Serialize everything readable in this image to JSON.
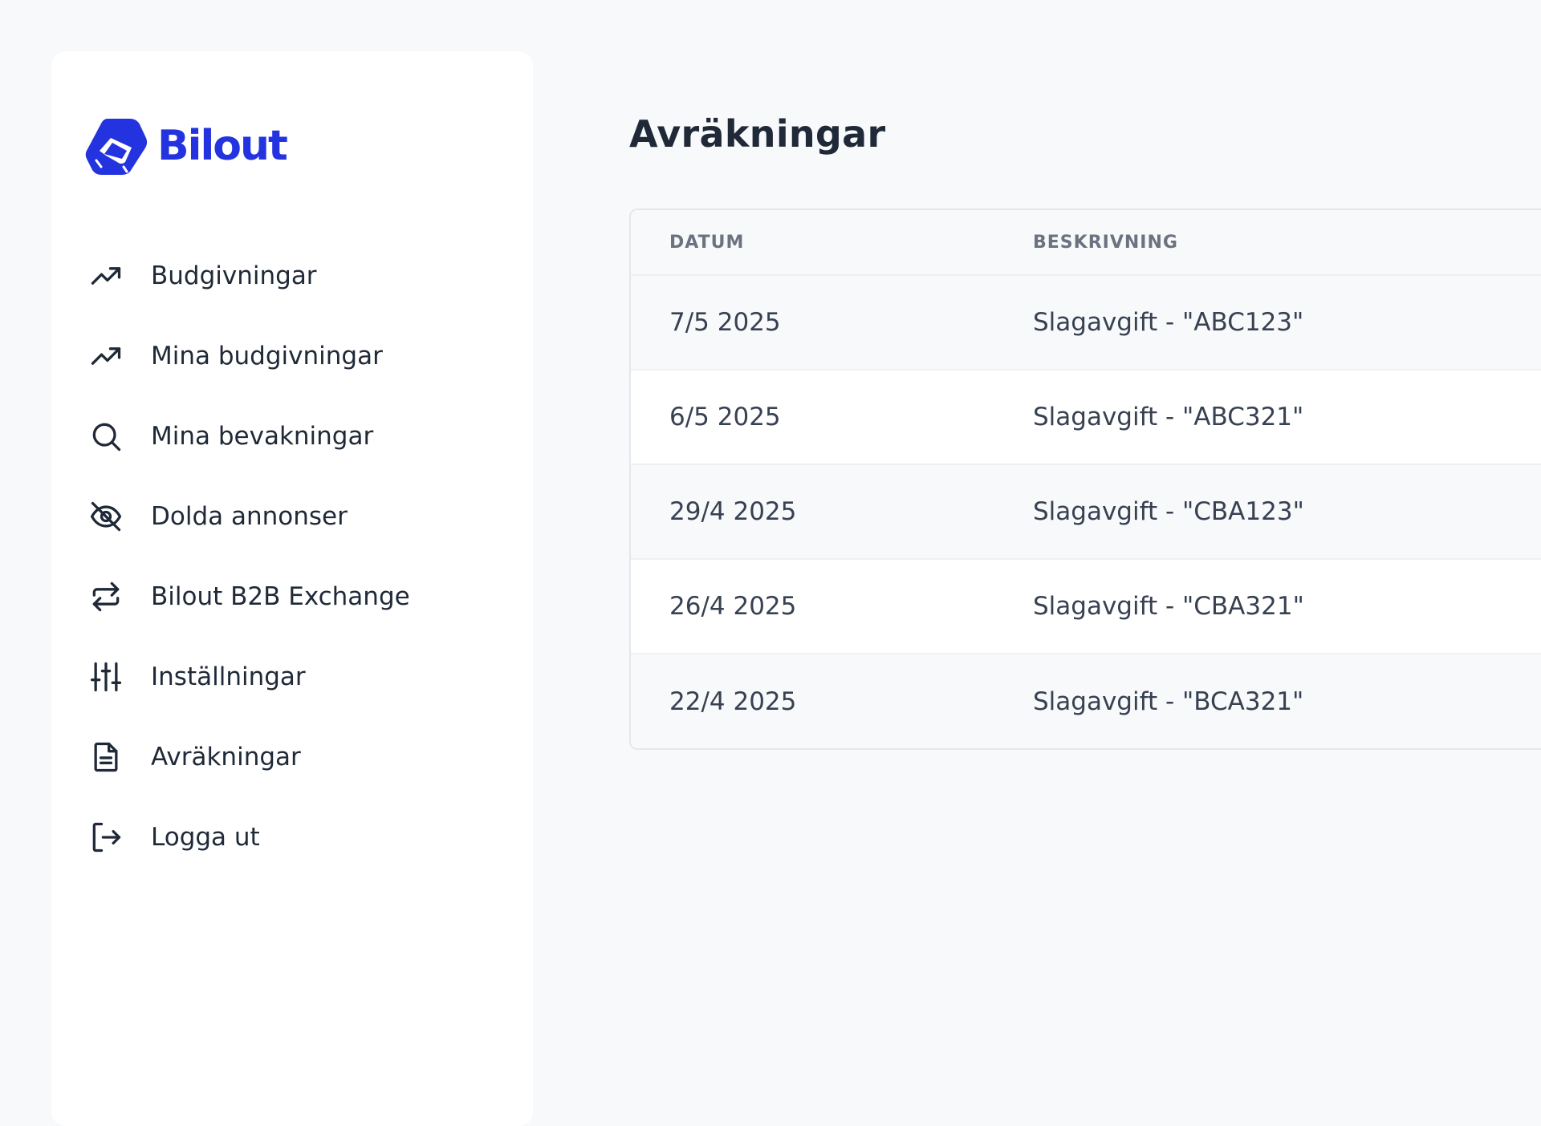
{
  "brand": {
    "name": "Bilout",
    "color": "#2433e0"
  },
  "sidebar": {
    "items": [
      {
        "label": "Budgivningar",
        "icon": "trending-up-icon"
      },
      {
        "label": "Mina budgivningar",
        "icon": "trending-up-icon"
      },
      {
        "label": "Mina bevakningar",
        "icon": "search-icon"
      },
      {
        "label": "Dolda annonser",
        "icon": "eye-off-icon"
      },
      {
        "label": "Bilout B2B Exchange",
        "icon": "repeat-icon"
      },
      {
        "label": "Inställningar",
        "icon": "sliders-icon"
      },
      {
        "label": "Avräkningar",
        "icon": "document-icon"
      },
      {
        "label": "Logga ut",
        "icon": "logout-icon"
      }
    ]
  },
  "main": {
    "title": "Avräkningar",
    "table": {
      "headers": {
        "date": "DATUM",
        "description": "BESKRIVNING"
      },
      "rows": [
        {
          "date": "7/5 2025",
          "description": "Slagavgift - \"ABC123\""
        },
        {
          "date": "6/5 2025",
          "description": "Slagavgift - \"ABC321\""
        },
        {
          "date": "29/4 2025",
          "description": "Slagavgift - \"CBA123\""
        },
        {
          "date": "26/4 2025",
          "description": "Slagavgift - \"CBA321\""
        },
        {
          "date": "22/4 2025",
          "description": "Slagavgift - \"BCA321\""
        }
      ]
    }
  }
}
